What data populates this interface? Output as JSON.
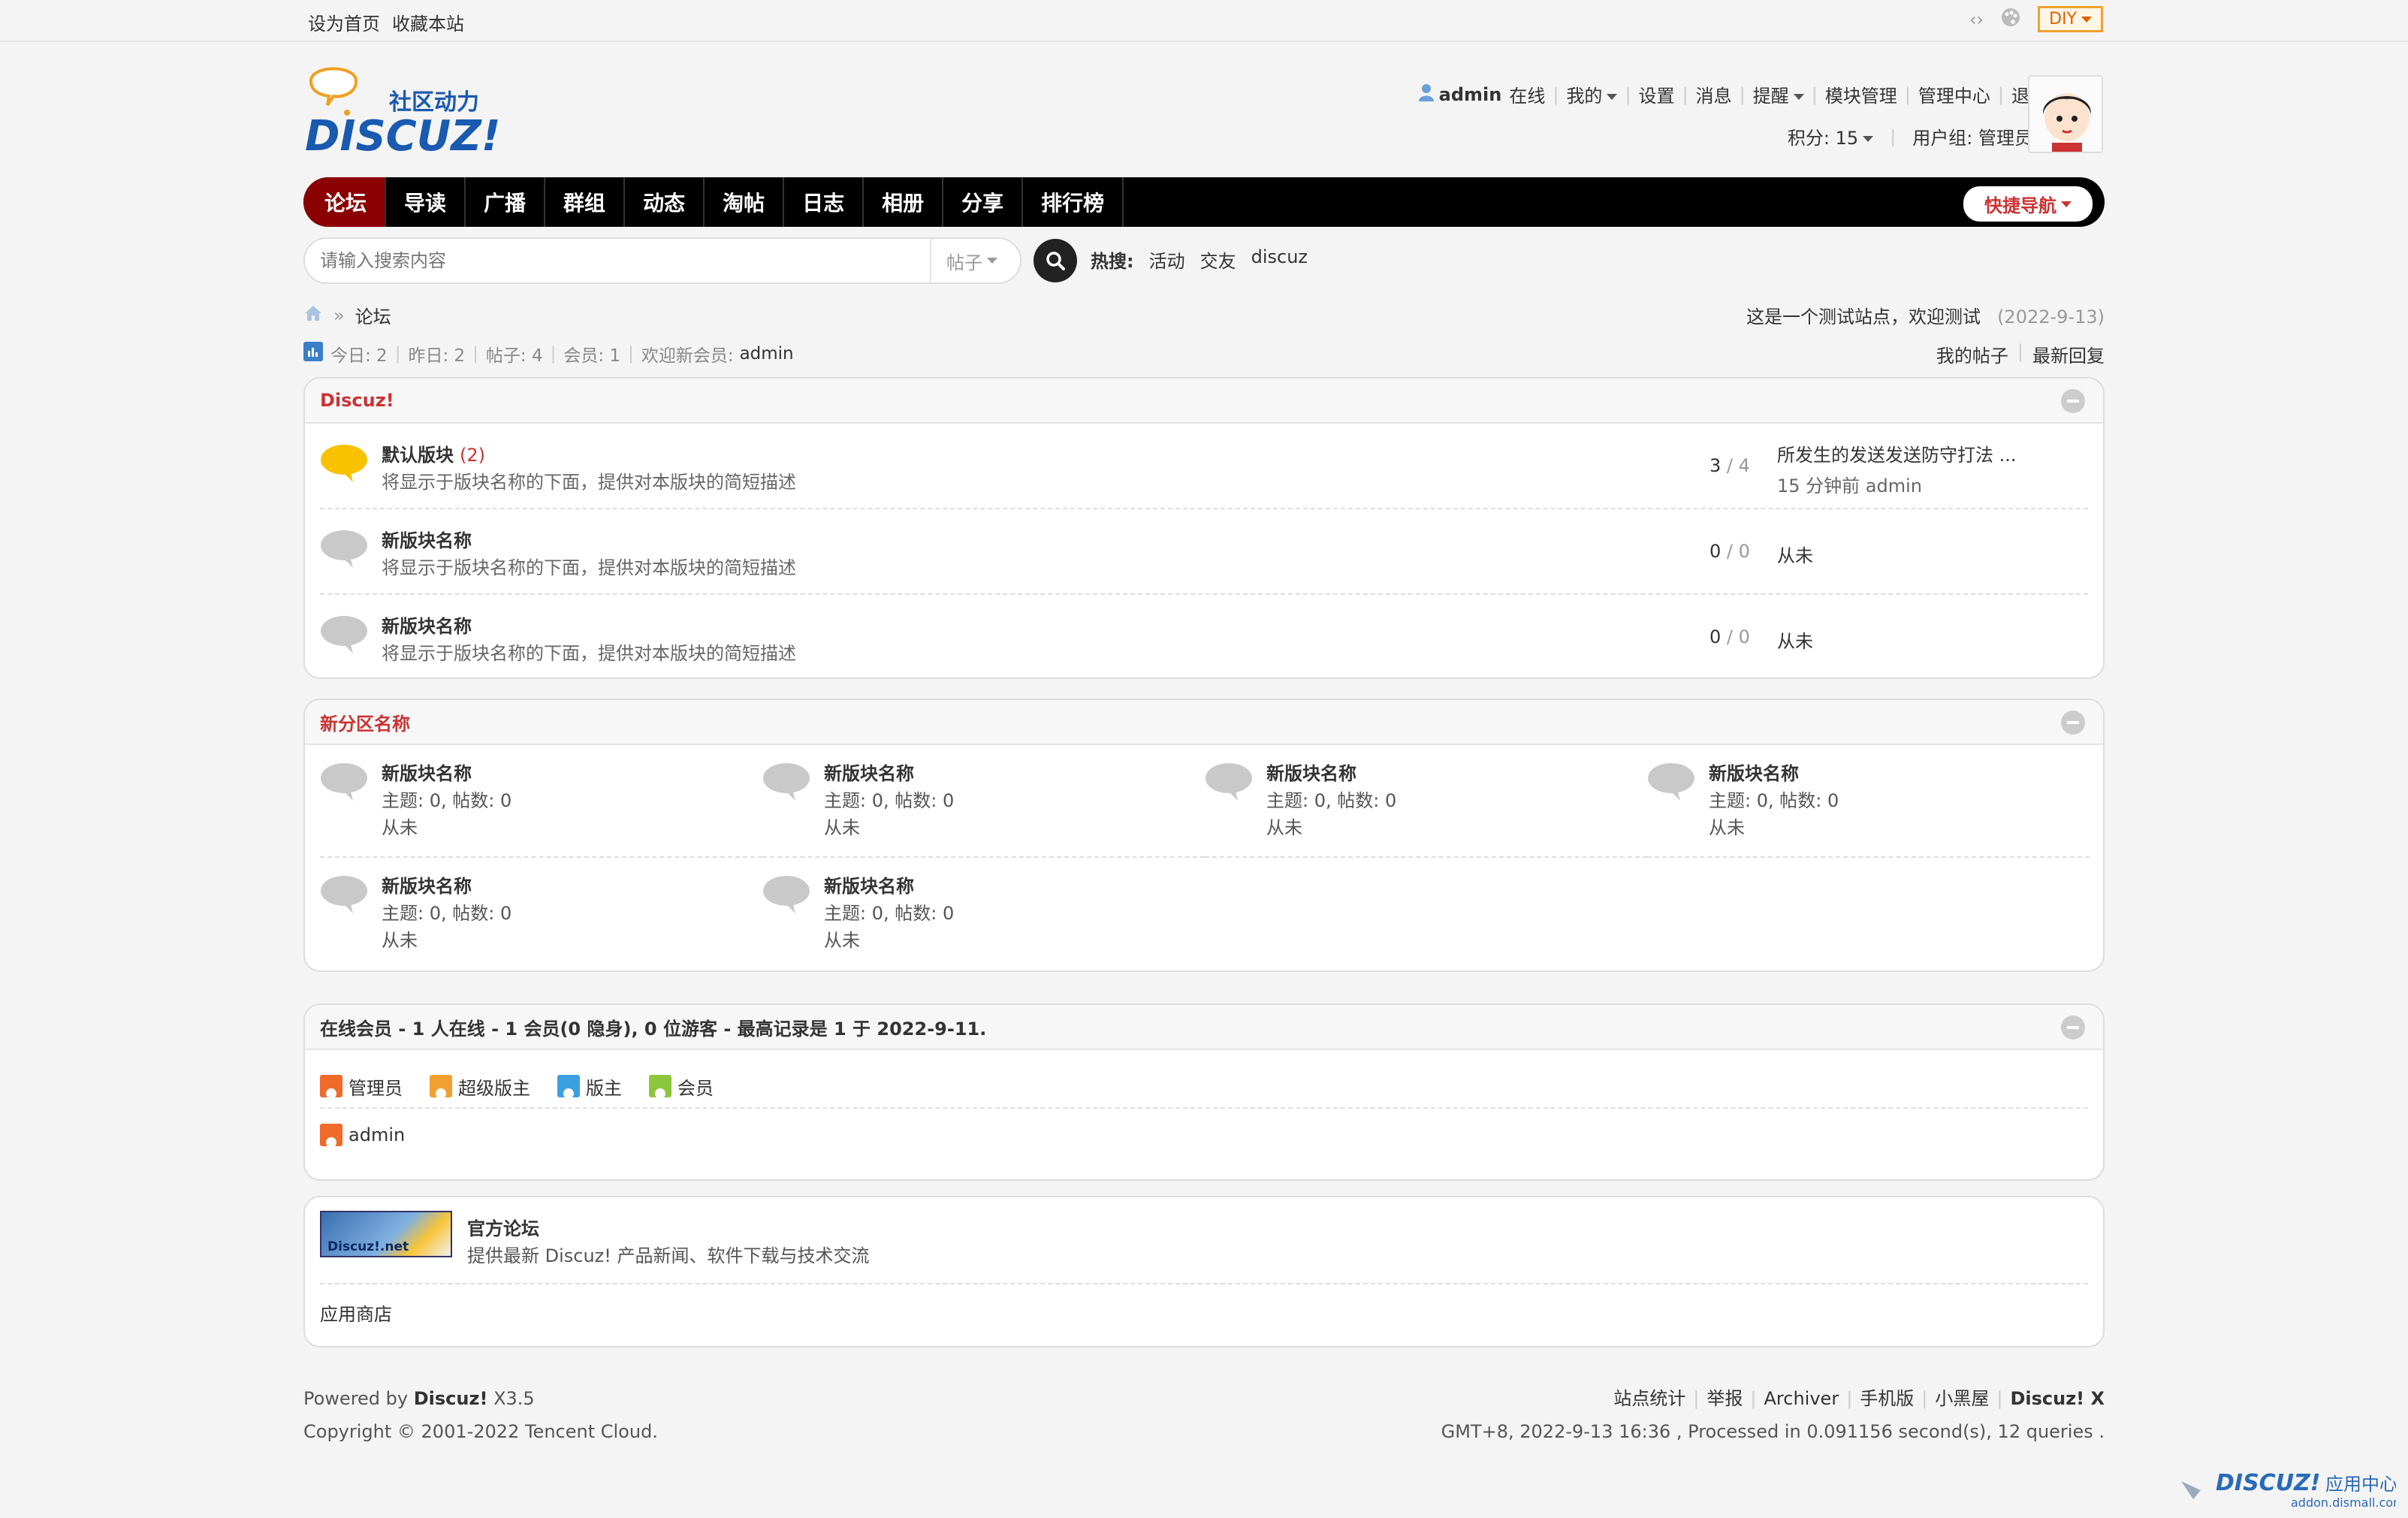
{
  "topbar": {
    "set_home": "设为首页",
    "bookmark": "收藏本站",
    "diy": "DIY"
  },
  "logo": {
    "cn": "社区动力",
    "en": "DISCUZ!"
  },
  "user": {
    "name": "admin",
    "status": "在线",
    "menu": [
      "我的",
      "设置",
      "消息",
      "提醒",
      "模块管理",
      "管理中心",
      "退出"
    ],
    "credits": "积分: 15",
    "group": "用户组: 管理员"
  },
  "nav": {
    "items": [
      "论坛",
      "导读",
      "广播",
      "群组",
      "动态",
      "淘帖",
      "日志",
      "相册",
      "分享",
      "排行榜"
    ],
    "quick": "快捷导航"
  },
  "search": {
    "placeholder": "请输入搜索内容",
    "type": "帖子",
    "hot_label": "热搜:",
    "hot": [
      "活动",
      "交友",
      "discuz"
    ]
  },
  "breadcrumb": {
    "current": "论坛"
  },
  "notice": {
    "text": "这是一个测试站点，欢迎测试",
    "date": "(2022-9-13)"
  },
  "stats": {
    "today": "今日: 2",
    "yesterday": "昨日: 2",
    "posts": "帖子: 4",
    "members": "会员: 1",
    "welcome": "欢迎新会员:",
    "new_member": "admin"
  },
  "links": {
    "my_posts": "我的帖子",
    "latest": "最新回复"
  },
  "section1": {
    "title": "Discuz!",
    "forums": [
      {
        "name": "默认版块",
        "count": "(2)",
        "desc": "将显示于版块名称的下面，提供对本版块的简短描述",
        "threads": "3",
        "posts": "4",
        "last": "所发生的发送发送防守打法 ...",
        "last_sub": "15 分钟前 admin",
        "active": true
      },
      {
        "name": "新版块名称",
        "count": "",
        "desc": "将显示于版块名称的下面，提供对本版块的简短描述",
        "threads": "0",
        "posts": "0",
        "last": "从未",
        "last_sub": "",
        "active": false
      },
      {
        "name": "新版块名称",
        "count": "",
        "desc": "将显示于版块名称的下面，提供对本版块的简短描述",
        "threads": "0",
        "posts": "0",
        "last": "从未",
        "last_sub": "",
        "active": false
      }
    ]
  },
  "section2": {
    "title": "新分区名称",
    "forums": [
      {
        "name": "新版块名称",
        "stats": "主题: 0, 帖数: 0",
        "last": "从未"
      },
      {
        "name": "新版块名称",
        "stats": "主题: 0, 帖数: 0",
        "last": "从未"
      },
      {
        "name": "新版块名称",
        "stats": "主题: 0, 帖数: 0",
        "last": "从未"
      },
      {
        "name": "新版块名称",
        "stats": "主题: 0, 帖数: 0",
        "last": "从未"
      },
      {
        "name": "新版块名称",
        "stats": "主题: 0, 帖数: 0",
        "last": "从未"
      },
      {
        "name": "新版块名称",
        "stats": "主题: 0, 帖数: 0",
        "last": "从未"
      }
    ]
  },
  "online": {
    "title": "在线会员 - 1 人在线 - 1 会员(0 隐身), 0 位游客 - 最高记录是 1 于 2022-9-11.",
    "legend": [
      {
        "label": "管理员",
        "color": "#f06a2a"
      },
      {
        "label": "超级版主",
        "color": "#f0a030"
      },
      {
        "label": "版主",
        "color": "#3aa0e0"
      },
      {
        "label": "会员",
        "color": "#8cc63f"
      }
    ],
    "users": [
      "admin"
    ]
  },
  "friendlink": {
    "title": "官方论坛",
    "desc": "提供最新 Discuz! 产品新闻、软件下载与技术交流",
    "img_text": "Discuz!.net",
    "app": "应用商店"
  },
  "footer": {
    "powered": "Powered by",
    "brand": "Discuz!",
    "version": "X3.5",
    "copyright": "Copyright © 2001-2022 Tencent Cloud.",
    "links": [
      "站点统计",
      "举报",
      "Archiver",
      "手机版",
      "小黑屋",
      "Discuz! X"
    ],
    "processed": "GMT+8, 2022-9-13 16:36 , Processed in 0.091156 second(s), 12 queries ."
  },
  "watermark": {
    "brand": "DISCUZ!",
    "cn": "应用中心",
    "site": "addon.dismall.com"
  }
}
